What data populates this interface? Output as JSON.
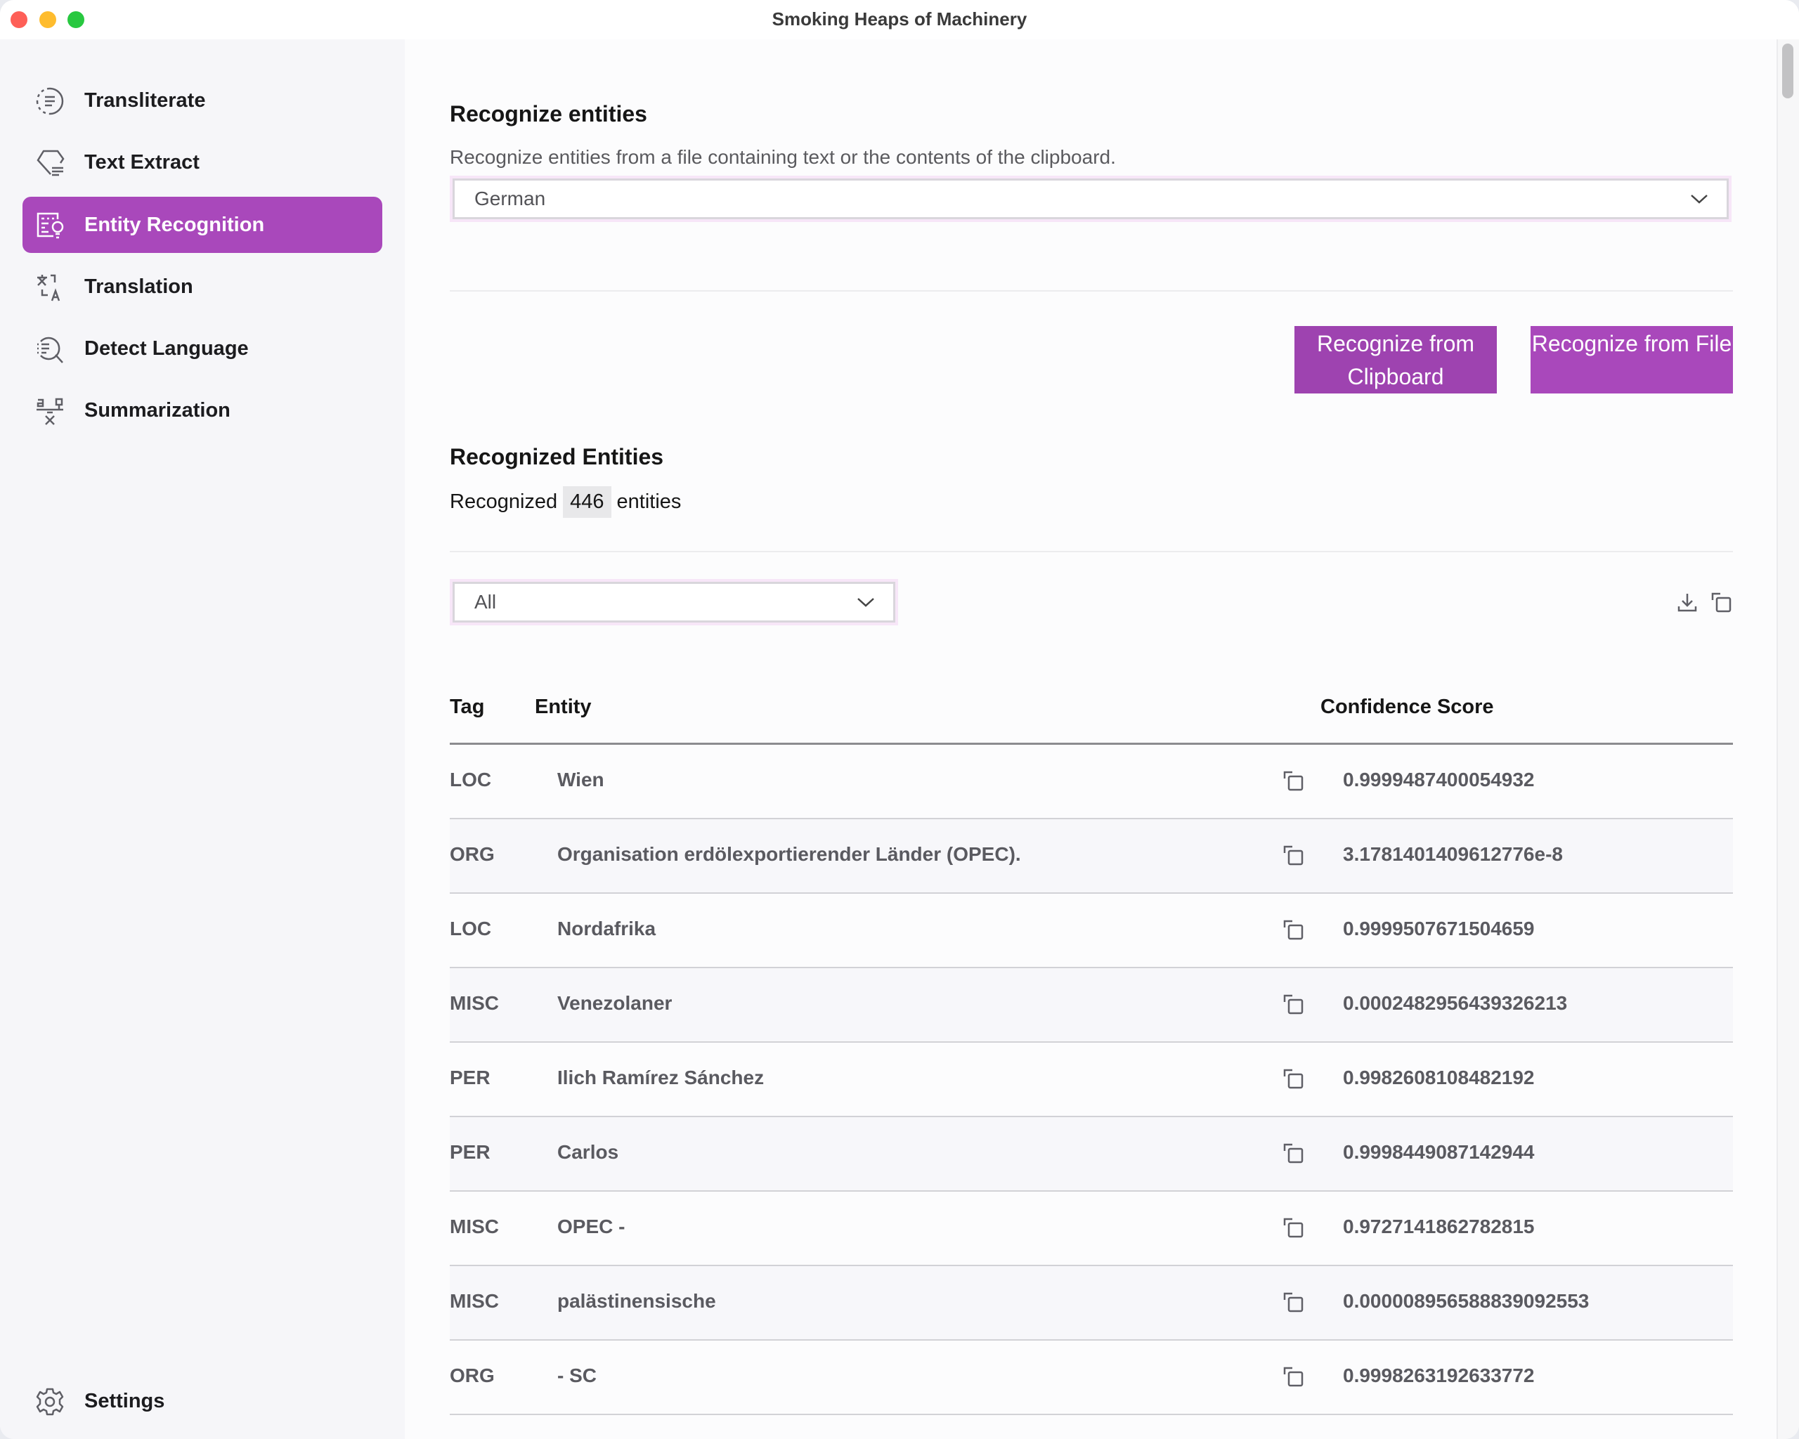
{
  "window": {
    "title": "Smoking Heaps of Machinery"
  },
  "sidebar": {
    "items": [
      {
        "label": "Transliterate",
        "icon": "transliterate-icon",
        "active": false
      },
      {
        "label": "Text Extract",
        "icon": "text-extract-icon",
        "active": false
      },
      {
        "label": "Entity Recognition",
        "icon": "entity-recognition-icon",
        "active": true
      },
      {
        "label": "Translation",
        "icon": "translation-icon",
        "active": false
      },
      {
        "label": "Detect Language",
        "icon": "detect-language-icon",
        "active": false
      },
      {
        "label": "Summarization",
        "icon": "summarization-icon",
        "active": false
      }
    ],
    "settings": {
      "label": "Settings",
      "icon": "gear-icon"
    }
  },
  "main": {
    "title": "Recognize entities",
    "description": "Recognize entities from a file containing text or the contents of the clipboard.",
    "language_select": {
      "value": "German"
    },
    "buttons": {
      "clipboard": "Recognize from Clipboard",
      "file": "Recognize from File"
    },
    "results": {
      "title": "Recognized Entities",
      "count_prefix": "Recognized",
      "count": "446",
      "count_suffix": "entities",
      "filter_select": {
        "value": "All"
      },
      "tools": {
        "download": "download-icon",
        "copy": "copy-icon"
      },
      "columns": {
        "tag": "Tag",
        "entity": "Entity",
        "score": "Confidence Score"
      },
      "rows": [
        {
          "tag": "LOC",
          "entity": "Wien",
          "score": "0.9999487400054932"
        },
        {
          "tag": "ORG",
          "entity": "Organisation erdölexportierender Länder (OPEC).",
          "score": "3.1781401409612776e-8"
        },
        {
          "tag": "LOC",
          "entity": "Nordafrika",
          "score": "0.9999507671504659"
        },
        {
          "tag": "MISC",
          "entity": "Venezolaner",
          "score": "0.0002482956439326213"
        },
        {
          "tag": "PER",
          "entity": "Ilich Ramírez Sánchez",
          "score": "0.9982608108482192"
        },
        {
          "tag": "PER",
          "entity": "Carlos",
          "score": "0.9998449087142944"
        },
        {
          "tag": "MISC",
          "entity": "OPEC -",
          "score": "0.9727141862782815"
        },
        {
          "tag": "MISC",
          "entity": "palästinensische",
          "score": "0.000008956588839092553"
        },
        {
          "tag": "ORG",
          "entity": "- SC",
          "score": "0.9998263192633772"
        }
      ]
    }
  },
  "colors": {
    "accent": "#a948bb",
    "accent_dark": "#9e43b0",
    "sidebar_bg": "#f6f6f9",
    "main_bg": "#fcfcfd"
  }
}
